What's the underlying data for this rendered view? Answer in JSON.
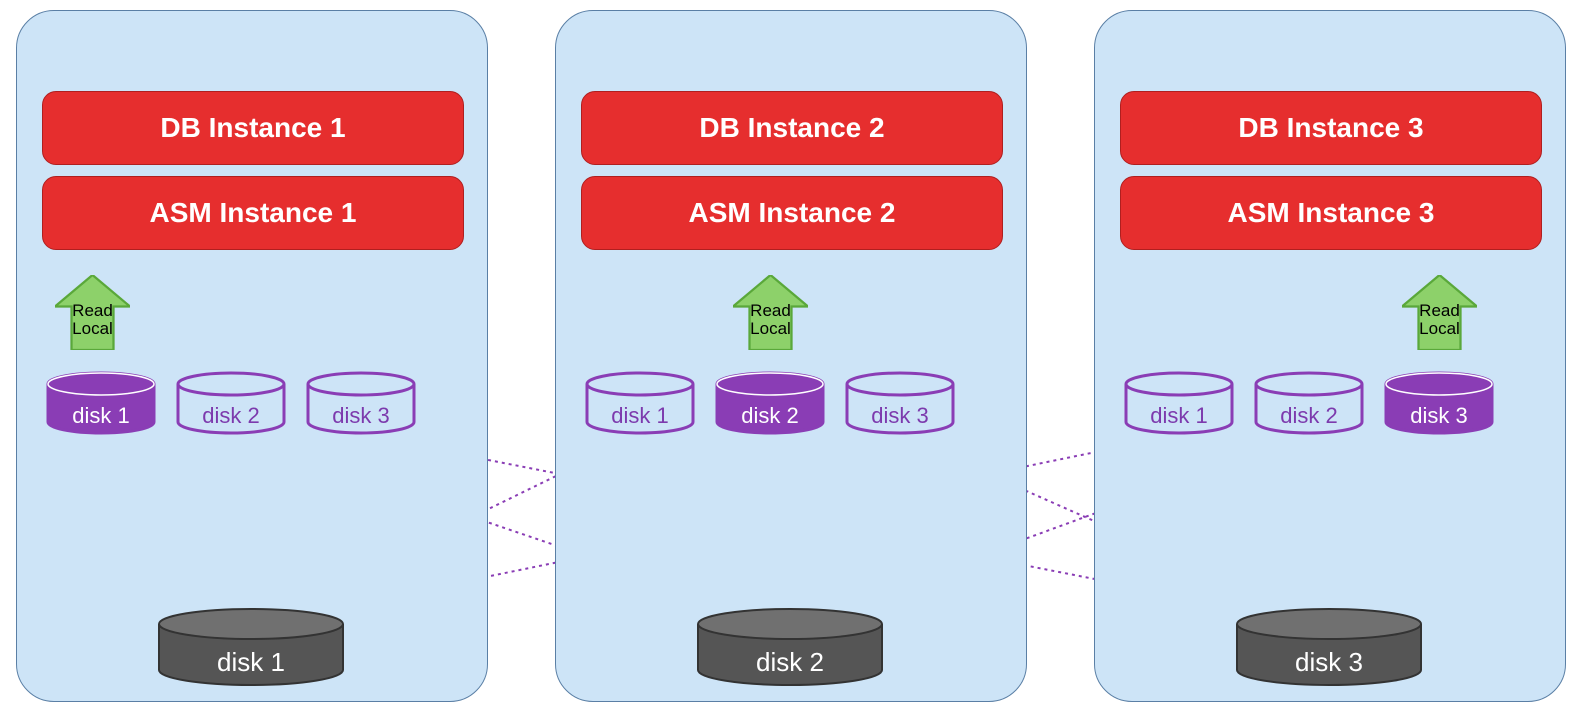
{
  "nodes": [
    {
      "db": "DB Instance 1",
      "asm": "ASM Instance 1",
      "arrow": "Read\nLocal",
      "disks": [
        "disk 1",
        "disk 2",
        "disk 3"
      ],
      "localIndex": 0,
      "bigDisk": "disk 1"
    },
    {
      "db": "DB Instance 2",
      "asm": "ASM Instance 2",
      "arrow": "Read\nLocal",
      "disks": [
        "disk 1",
        "disk 2",
        "disk 3"
      ],
      "localIndex": 1,
      "bigDisk": "disk 2"
    },
    {
      "db": "DB Instance 3",
      "asm": "ASM Instance 3",
      "arrow": "Read\nLocal",
      "disks": [
        "disk 1",
        "disk 2",
        "disk 3"
      ],
      "localIndex": 2,
      "bigDisk": "disk 3"
    }
  ],
  "colors": {
    "card": "#cde4f7",
    "red": "#e62e2e",
    "green": "#8dd16a",
    "greenStroke": "#5aa83a",
    "purple": "#8a3db5",
    "grey": "#555555",
    "greyTop": "#707070"
  }
}
